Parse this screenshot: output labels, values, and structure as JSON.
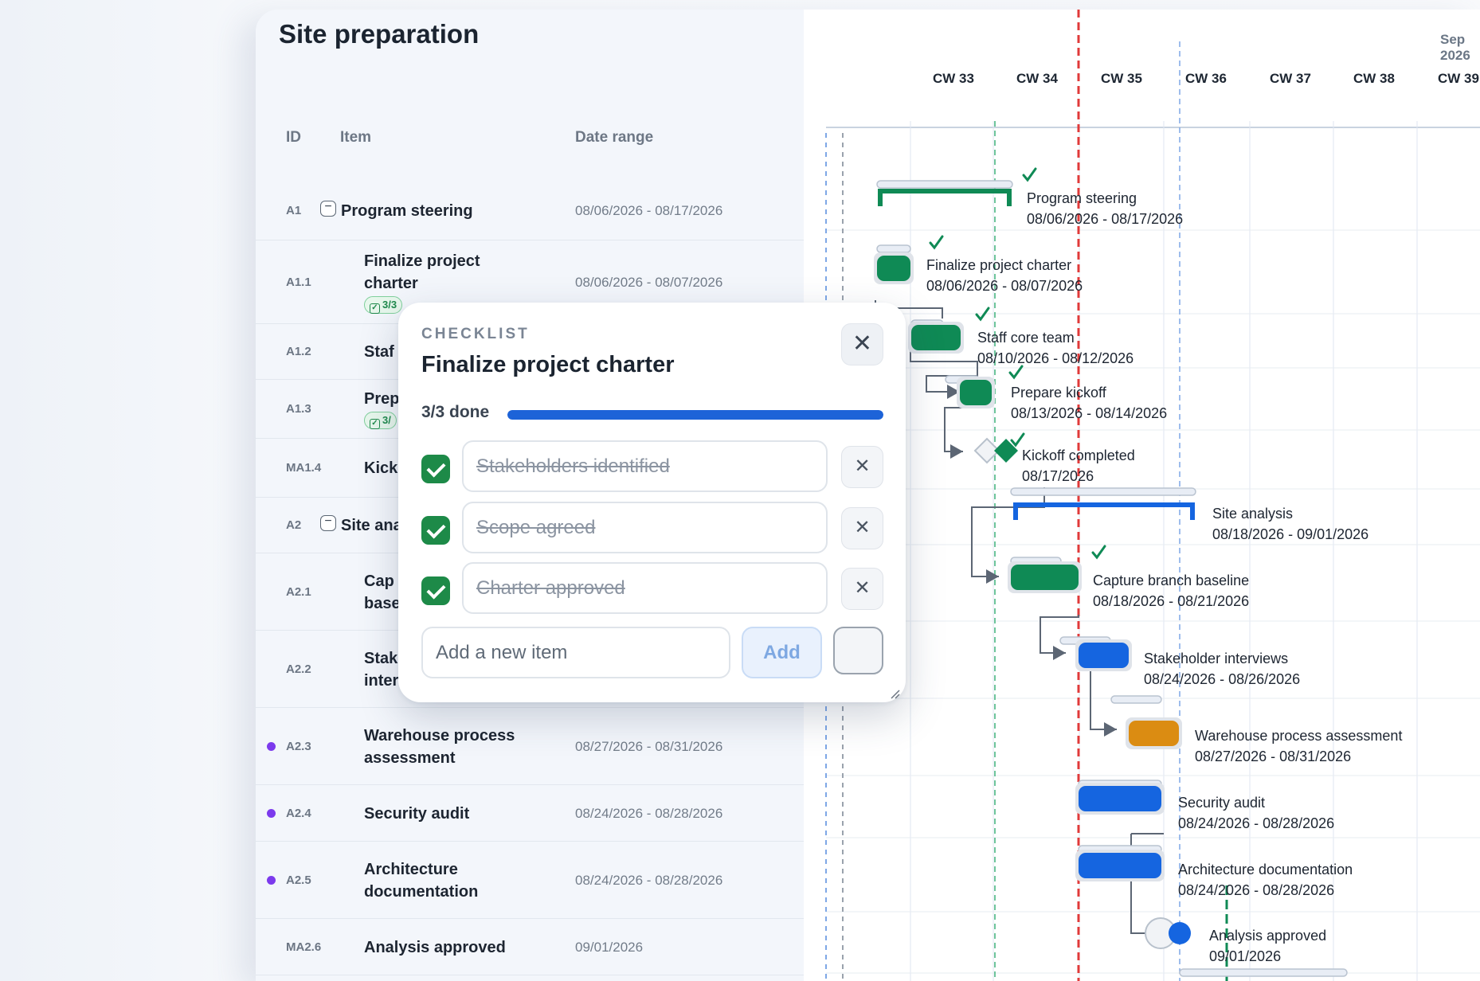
{
  "title": "Site preparation",
  "columns": {
    "id": "ID",
    "item": "Item",
    "date_range": "Date range"
  },
  "rows": [
    {
      "id": "A1",
      "name": "Program steering",
      "date": "08/06/2026 - 08/17/2026"
    },
    {
      "id": "A1.1",
      "name": "Finalize project\ncharter",
      "date": "08/06/2026 - 08/07/2026",
      "badge": "3/3"
    },
    {
      "id": "A1.2",
      "name": "Staf",
      "date": ""
    },
    {
      "id": "A1.3",
      "name": "Prep",
      "date": "",
      "badge": "3/"
    },
    {
      "id": "MA1.4",
      "name": "Kick",
      "date": ""
    },
    {
      "id": "A2",
      "name": "Site ana",
      "date": ""
    },
    {
      "id": "A2.1",
      "name": "Cap\nbase",
      "date": ""
    },
    {
      "id": "A2.2",
      "name": "Stak\ninter",
      "date": ""
    },
    {
      "id": "A2.3",
      "name": "Warehouse process\nassessment",
      "date": "08/27/2026 - 08/31/2026"
    },
    {
      "id": "A2.4",
      "name": "Security audit",
      "date": "08/24/2026 - 08/28/2026"
    },
    {
      "id": "A2.5",
      "name": "Architecture\ndocumentation",
      "date": "08/24/2026 - 08/28/2026"
    },
    {
      "id": "MA2.6",
      "name": "Analysis approved",
      "date": "09/01/2026"
    }
  ],
  "gantt": {
    "month": "Sep 2026",
    "weeks": [
      "CW 33",
      "CW 34",
      "CW 35",
      "CW 36",
      "CW 37",
      "CW 38",
      "CW 39"
    ],
    "labels": [
      {
        "name": "Program steering",
        "date": "08/06/2026 - 08/17/2026"
      },
      {
        "name": "Finalize project charter",
        "date": "08/06/2026 - 08/07/2026"
      },
      {
        "name": "Staff core team",
        "date": "08/10/2026 - 08/12/2026"
      },
      {
        "name": "Prepare kickoff",
        "date": "08/13/2026 - 08/14/2026"
      },
      {
        "name": "Kickoff completed",
        "date": "08/17/2026"
      },
      {
        "name": "Site analysis",
        "date": "08/18/2026 - 09/01/2026"
      },
      {
        "name": "Capture branch baseline",
        "date": "08/18/2026 - 08/21/2026"
      },
      {
        "name": "Stakeholder interviews",
        "date": "08/24/2026 - 08/26/2026"
      },
      {
        "name": "Warehouse process assessment",
        "date": "08/27/2026 - 08/31/2026"
      },
      {
        "name": "Security audit",
        "date": "08/24/2026 - 08/28/2026"
      },
      {
        "name": "Architecture documentation",
        "date": "08/24/2026 - 08/28/2026"
      },
      {
        "name": "Analysis approved",
        "date": "09/01/2026"
      }
    ],
    "colors": {
      "done": "#0f8a55",
      "active": "#1565e0",
      "warning": "#db8c12",
      "today": "#e03a3a"
    }
  },
  "checklist": {
    "kicker": "CHECKLIST",
    "title": "Finalize project charter",
    "progress_label": "3/3 done",
    "progress": 1.0,
    "items": [
      "Stakeholders identified",
      "Scope agreed",
      "Charter approved"
    ],
    "new_placeholder": "Add a new item",
    "add_label": "Add"
  }
}
